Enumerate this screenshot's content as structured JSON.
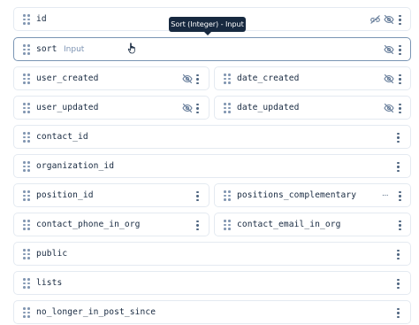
{
  "tooltip": {
    "text": "Sort (Integer) - Input"
  },
  "fields": {
    "id": {
      "label": "id"
    },
    "sort": {
      "label": "sort",
      "interface": "Input"
    },
    "user_created": {
      "label": "user_created"
    },
    "date_created": {
      "label": "date_created"
    },
    "user_updated": {
      "label": "user_updated"
    },
    "date_updated": {
      "label": "date_updated"
    },
    "contact_id": {
      "label": "contact_id"
    },
    "organization_id": {
      "label": "organization_id"
    },
    "position_id": {
      "label": "position_id"
    },
    "positions_complementary": {
      "label": "positions_complementary",
      "overflow": "..."
    },
    "contact_phone_in_org": {
      "label": "contact_phone_in_org"
    },
    "contact_email_in_org": {
      "label": "contact_email_in_org"
    },
    "public": {
      "label": "public"
    },
    "lists": {
      "label": "lists"
    },
    "no_longer_in_post_since": {
      "label": "no_longer_in_post_since"
    }
  },
  "icons": {
    "drag": "drag-handle-icon",
    "hidden": "eye-off-icon",
    "link": "link-icon",
    "more": "more-vert-icon"
  },
  "colors": {
    "text": "#172940",
    "muted": "#7c93b3",
    "border": "#e4eaf1",
    "active_border": "#7a95b4",
    "tooltip_bg": "#172940"
  }
}
